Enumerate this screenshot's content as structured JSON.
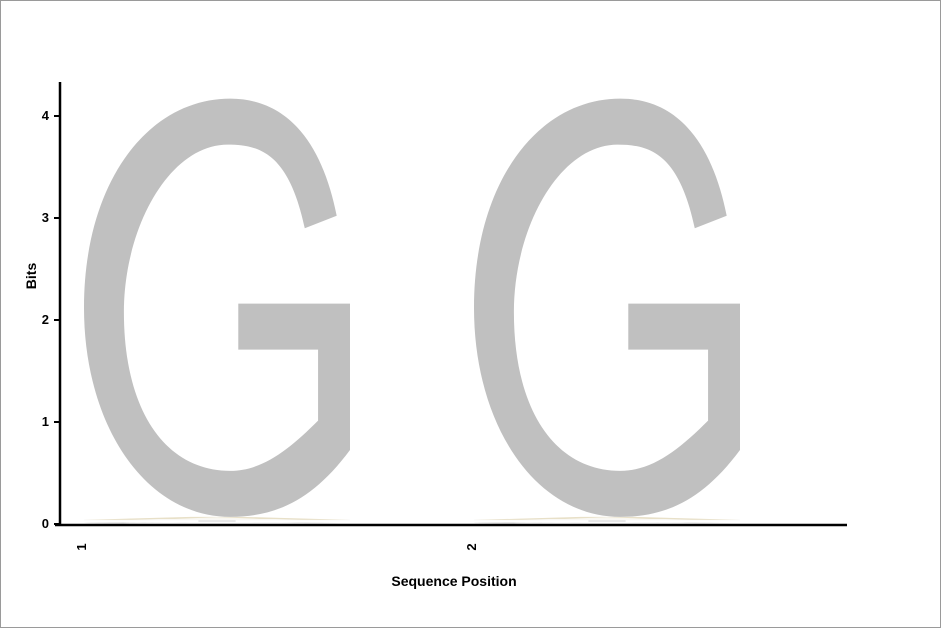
{
  "chart_data": {
    "type": "sequence-logo",
    "title": "",
    "xlabel": "Sequence Position",
    "ylabel": "Bits",
    "ylim": [
      0,
      4
    ],
    "yticks": [
      "0",
      "1",
      "2",
      "3",
      "4"
    ],
    "positions": [
      {
        "label": "1",
        "stack": [
          {
            "letter": "G",
            "bits": 4.1,
            "color": "#c0c0c0"
          },
          {
            "letter": "A",
            "bits": 0.03,
            "color": "#e8e0c8"
          },
          {
            "letter": "C",
            "bits": 0.02,
            "color": "#e0e0e0"
          },
          {
            "letter": "T",
            "bits": 0.02,
            "color": "#e8e8e8"
          }
        ]
      },
      {
        "label": "2",
        "stack": [
          {
            "letter": "G",
            "bits": 4.1,
            "color": "#c0c0c0"
          },
          {
            "letter": "A",
            "bits": 0.03,
            "color": "#e8e0c8"
          },
          {
            "letter": "C",
            "bits": 0.02,
            "color": "#e0e0e0"
          },
          {
            "letter": "T",
            "bits": 0.02,
            "color": "#e8e8e8"
          }
        ]
      }
    ],
    "grid": false,
    "legend": "none"
  }
}
